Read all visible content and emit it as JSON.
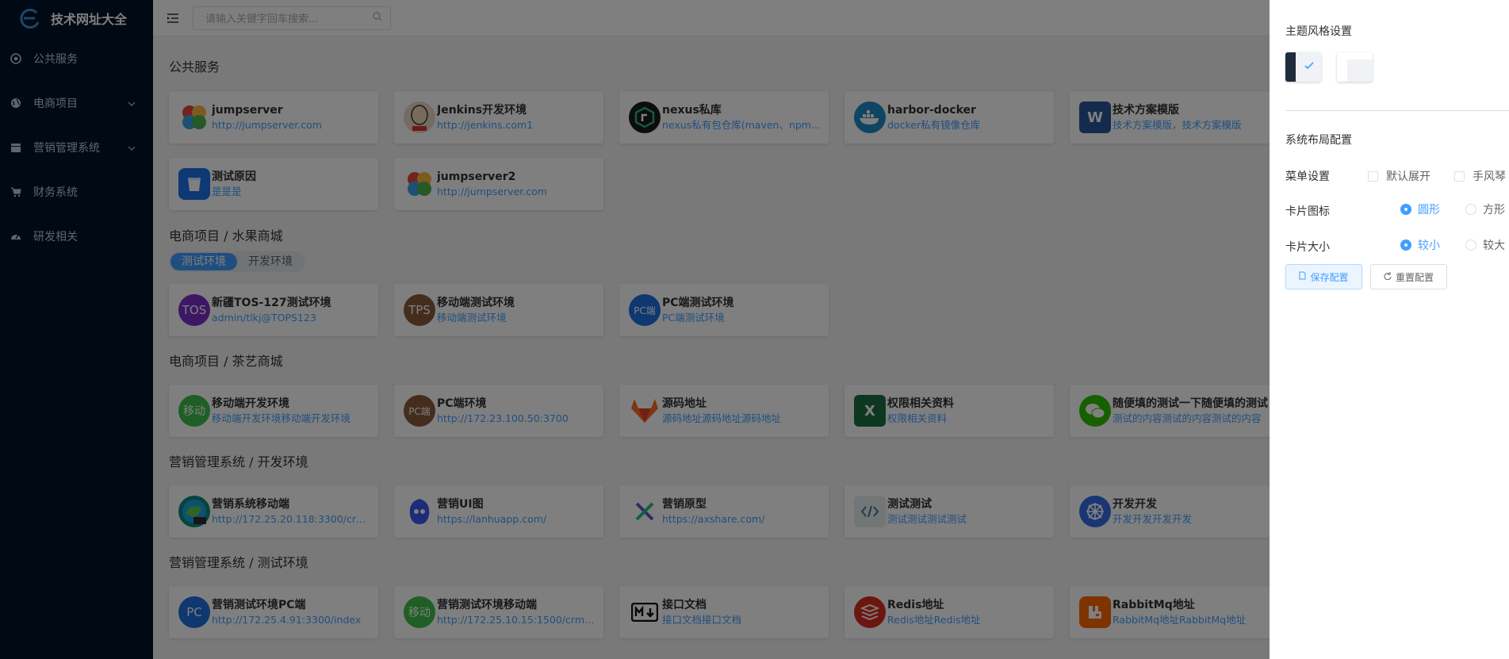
{
  "app": {
    "title": "技术网址大全"
  },
  "sidebar": {
    "items": [
      {
        "label": "公共服务",
        "icon": "aperture-icon"
      },
      {
        "label": "电商项目",
        "icon": "globe-icon"
      },
      {
        "label": "营销管理系统",
        "icon": "calendar-icon"
      },
      {
        "label": "财务系统",
        "icon": "cart-icon"
      },
      {
        "label": "研发相关",
        "icon": "gauge-icon"
      }
    ]
  },
  "search": {
    "placeholder": "请输入关键字回车搜索..."
  },
  "sections": {
    "s1": {
      "title": "公共服务"
    },
    "s2": {
      "title": "电商项目 / 水果商城",
      "tab1": "测试环境",
      "tab2": "开发环境"
    },
    "s3": {
      "title": "电商项目 / 茶艺商城"
    },
    "s4": {
      "title": "营销管理系统 / 开发环境"
    },
    "s5": {
      "title": "营销管理系统 / 测试环境"
    }
  },
  "cards": {
    "c1": {
      "name": "jumpserver",
      "desc": "http://jumpserver.com",
      "icon": "jumpserver-logo-icon"
    },
    "c2": {
      "name": "Jenkins开发环境",
      "desc": "http://jenkins.com1",
      "icon": "jenkins-logo-icon"
    },
    "c3": {
      "name": "nexus私库",
      "desc": "nexus私有包仓库(maven、npm...",
      "icon": "nexus-logo-icon"
    },
    "c4": {
      "name": "harbor-docker",
      "desc": "docker私有镜像仓库",
      "icon": "docker-logo-icon"
    },
    "c5": {
      "name": "技术方案模版",
      "desc": "技术方案模版，技术方案模版",
      "icon": "word-logo-icon"
    },
    "c6": {
      "name": "测试原因",
      "desc": "是是是",
      "icon": "bucket-icon"
    },
    "c7": {
      "name": "jumpserver2",
      "desc": "http://jumpserver.com",
      "icon": "jumpserver-logo-icon"
    },
    "c8": {
      "name": "新疆TOS-127测试环境",
      "desc": "admin/tlkj@TOPS123",
      "badge": "TOS"
    },
    "c9": {
      "name": "移动端测试环境",
      "desc": "移动端测试环境",
      "badge": "TPS"
    },
    "c10": {
      "name": "PC端测试环境",
      "desc": "PC端测试环境",
      "badge": "PC端"
    },
    "c11": {
      "name": "移动端开发环境",
      "desc": "移动端开发环境移动端开发环境",
      "badge": "移动"
    },
    "c12": {
      "name": "PC端环境",
      "desc": "http://172.23.100.50:3700",
      "badge": "PC端"
    },
    "c13": {
      "name": "源码地址",
      "desc": "源码地址源码地址源码地址",
      "icon": "gitlab-logo-icon"
    },
    "c14": {
      "name": "权限相关资料",
      "desc": "权限相关资料",
      "icon": "excel-logo-icon"
    },
    "c15": {
      "name": "随便填的测试一下随便填的测试",
      "desc": "测试的内容测试的内容测试的内容",
      "icon": "wechat-logo-icon"
    },
    "c16": {
      "name": "营销系统移动端",
      "desc": "http://172.25.20.118:3300/crm/m...",
      "icon": "edge-dev-logo-icon"
    },
    "c17": {
      "name": "营销UI图",
      "desc": "https://lanhuapp.com/",
      "icon": "lanhu-logo-icon"
    },
    "c18": {
      "name": "营销原型",
      "desc": "https://axshare.com/",
      "icon": "axure-logo-icon"
    },
    "c19": {
      "name": "测试测试",
      "desc": "测试测试测试测试",
      "icon": "code-icon"
    },
    "c20": {
      "name": "开发开发",
      "desc": "开发开发开发开发",
      "icon": "kubernetes-logo-icon"
    },
    "c21": {
      "name": "营销测试环境PC端",
      "desc": "http://172.25.4.91:3300/index",
      "badge": "PC"
    },
    "c22": {
      "name": "营销测试环境移动端",
      "desc": "http://172.25.10.15:1500/crm/m...",
      "badge": "移动"
    },
    "c23": {
      "name": "接口文档",
      "desc": "接口文档接口文档",
      "icon": "markdown-icon"
    },
    "c24": {
      "name": "Redis地址",
      "desc": "Redis地址Redis地址",
      "icon": "redis-logo-icon"
    },
    "c25": {
      "name": "RabbitMq地址",
      "desc": "RabbitMq地址RabbitMq地址",
      "icon": "rabbitmq-logo-icon"
    }
  },
  "drawer": {
    "theme_title": "主题风格设置",
    "layout_title": "系统布局配置",
    "menu_label": "菜单设置",
    "menu_opt1": "默认展开",
    "menu_opt2": "手风琴",
    "icon_label": "卡片图标",
    "icon_opt1": "圆形",
    "icon_opt2": "方形",
    "size_label": "卡片大小",
    "size_opt1": "较小",
    "size_opt2": "较大",
    "save_label": "保存配置",
    "reset_label": "重置配置"
  },
  "colors": {
    "accent": "#409eff",
    "sidebar": "#021428"
  }
}
